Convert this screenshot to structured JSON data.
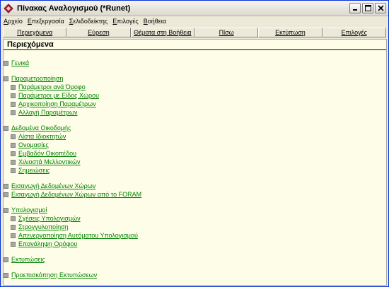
{
  "window": {
    "title": "Πίνακας Αναλογισμού (*Runet)"
  },
  "menu": [
    {
      "label": "Αρχείο"
    },
    {
      "label": "Επεξεργασία"
    },
    {
      "label": "Σελιδοδείκτης"
    },
    {
      "label": "Επιλογές"
    },
    {
      "label": "Βοήθεια"
    }
  ],
  "toolbar": [
    {
      "label": "Περιεχόμενα"
    },
    {
      "label": "Εύρεση"
    },
    {
      "label": "Θέματα στη Βοήθεια"
    },
    {
      "label": "Πίσω"
    },
    {
      "label": "Εκτύπωση"
    },
    {
      "label": "Επιλογές"
    }
  ],
  "content": {
    "header": "Περιεχόμενα",
    "sections": [
      {
        "title": "Γενικά",
        "items": []
      },
      {
        "title": "Παραμετροποίηση",
        "items": [
          "Παράμετροι ανά Όροφο",
          "Παράμετροι με Είδος Χώρου",
          "Αρχικοποίηση Παραμέτρων",
          "Αλλαγή Παραμέτρων"
        ]
      },
      {
        "title": "Δεδομένα Οικοδομής",
        "items": [
          "Λίστα Ιδιοκτητών",
          "Ονομασίες",
          "Εμβαδόν Οικοπέδου",
          "Χιλιοστά Μελλοντικών",
          "Σημειώσεις"
        ]
      },
      {
        "title": "Εισαγωγή Δεδομένων Χώρων",
        "items": []
      },
      {
        "title": "Εισαγωγή Δεδομένων Χώρων από το FORAM",
        "items": []
      },
      {
        "title": "Υπολογισμοί",
        "items": [
          "Σχέσεις Υπολογισμών",
          "Στρογγυλοποίηση",
          "Απενεργοποίηση Αυτόματου Υπολογισμού",
          "Επανάληψη Ορόφου"
        ]
      },
      {
        "title": "Εκτυπώσεις",
        "items": []
      },
      {
        "title": "Προεπισκόπηση Εκτυπώσεων",
        "items": []
      }
    ]
  }
}
